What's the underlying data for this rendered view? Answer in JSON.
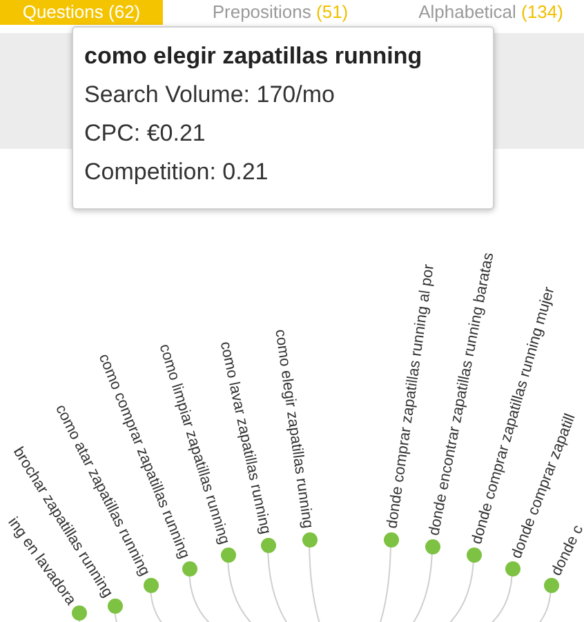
{
  "tabs": [
    {
      "label": "Questions",
      "count": "(62)",
      "selected": true
    },
    {
      "label": "Prepositions",
      "count": "(51)",
      "selected": false
    },
    {
      "label": "Alphabetical",
      "count": "(134)",
      "selected": false
    }
  ],
  "tooltip": {
    "title": "como elegir zapatillas running",
    "lines": [
      "Search Volume: 170/mo",
      "CPC: €0.21",
      "Competition: 0.21"
    ]
  },
  "tree": {
    "nodes": [
      {
        "label": "ing en lavadora",
        "kind": "left"
      },
      {
        "label": "brochar zapatillas running",
        "kind": "left"
      },
      {
        "label": "como atar zapatillas running",
        "kind": "left"
      },
      {
        "label": "como comprar zapatillas running",
        "kind": "left"
      },
      {
        "label": "como limpiar zapatillas running",
        "kind": "left"
      },
      {
        "label": "como lavar zapatillas running",
        "kind": "left"
      },
      {
        "label": "como elegir zapatillas running",
        "kind": "left"
      },
      {
        "label": "donde comprar zapatillas running al por",
        "kind": "right"
      },
      {
        "label": "donde encontrar zapatillas running baratas",
        "kind": "right"
      },
      {
        "label": "donde comprar zapatillas running mujer",
        "kind": "right"
      },
      {
        "label": "donde comprar zapatill",
        "kind": "right"
      },
      {
        "label": "donde c",
        "kind": "right"
      }
    ]
  }
}
